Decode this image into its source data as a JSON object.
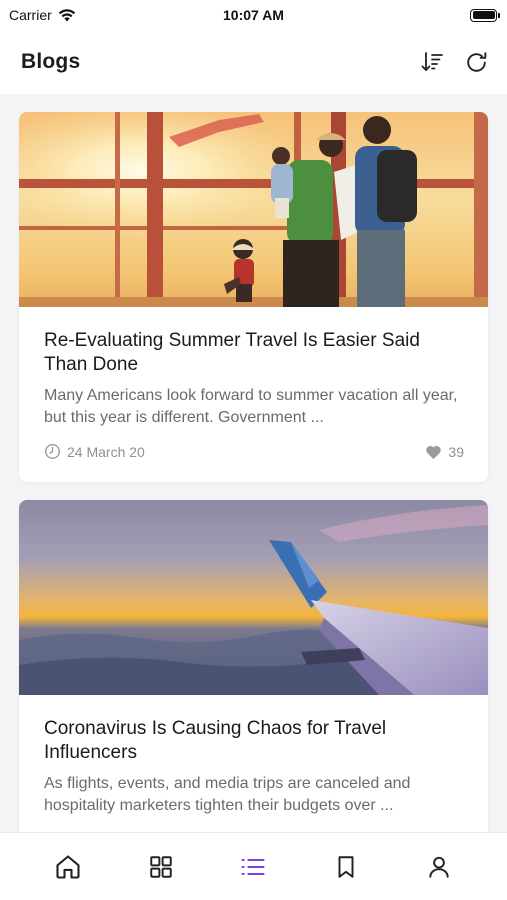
{
  "status_bar": {
    "carrier": "Carrier",
    "time": "10:07 AM"
  },
  "header": {
    "title": "Blogs",
    "sort_icon": "sort-descending-icon",
    "refresh_icon": "refresh-icon"
  },
  "posts": [
    {
      "title": "Re-Evaluating Summer Travel Is Easier Said Than Done",
      "excerpt": "Many Americans look forward to summer vacation all year, but this year is different. Government ...",
      "date": "24 March 20",
      "likes": "39",
      "image": "family-at-airport-window-sunset"
    },
    {
      "title": "Coronavirus Is Causing Chaos for Travel Influencers",
      "excerpt": "As flights, events, and media trips are canceled and hospitality marketers tighten their budgets over ...",
      "image": "airplane-wing-above-clouds"
    }
  ],
  "nav": {
    "items": [
      "home-icon",
      "grid-icon",
      "list-icon",
      "bookmark-icon",
      "profile-icon"
    ],
    "active": "list-icon"
  },
  "colors": {
    "accent": "#7b3fe4",
    "icon": "#222222",
    "muted": "#8f8f8f"
  }
}
